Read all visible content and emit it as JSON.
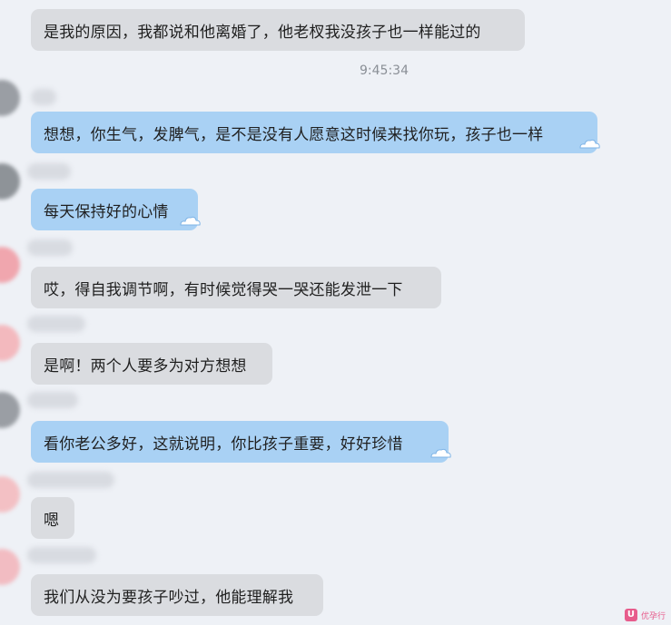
{
  "messages": [
    {
      "text": "是我的原因，我都说和他离婚了，他老杈我没孩子也一样能过的",
      "side": "gray"
    },
    {
      "text": "想想，你生气，发脾气，是不是没有人愿意这时候来找你玩，孩子也一样",
      "side": "blue"
    },
    {
      "text": "每天保持好的心情",
      "side": "blue"
    },
    {
      "text": "哎，得自我调节啊，有时候觉得哭一哭还能发泄一下",
      "side": "gray"
    },
    {
      "text": "是啊！两个人要多为对方想想",
      "side": "gray"
    },
    {
      "text": "看你老公多好，这就说明，你比孩子重要，好好珍惜",
      "side": "blue"
    },
    {
      "text": "嗯",
      "side": "gray"
    },
    {
      "text": "我们从没为要孩子吵过，他能理解我",
      "side": "gray"
    }
  ],
  "timestamp": "9:45:34",
  "watermark": {
    "text": "优孕行",
    "badge": "U"
  },
  "colors": {
    "background": "#eef1f6",
    "bubble_gray": "#dadce0",
    "bubble_blue": "#a9d1f4",
    "watermark": "#e75c8c"
  }
}
